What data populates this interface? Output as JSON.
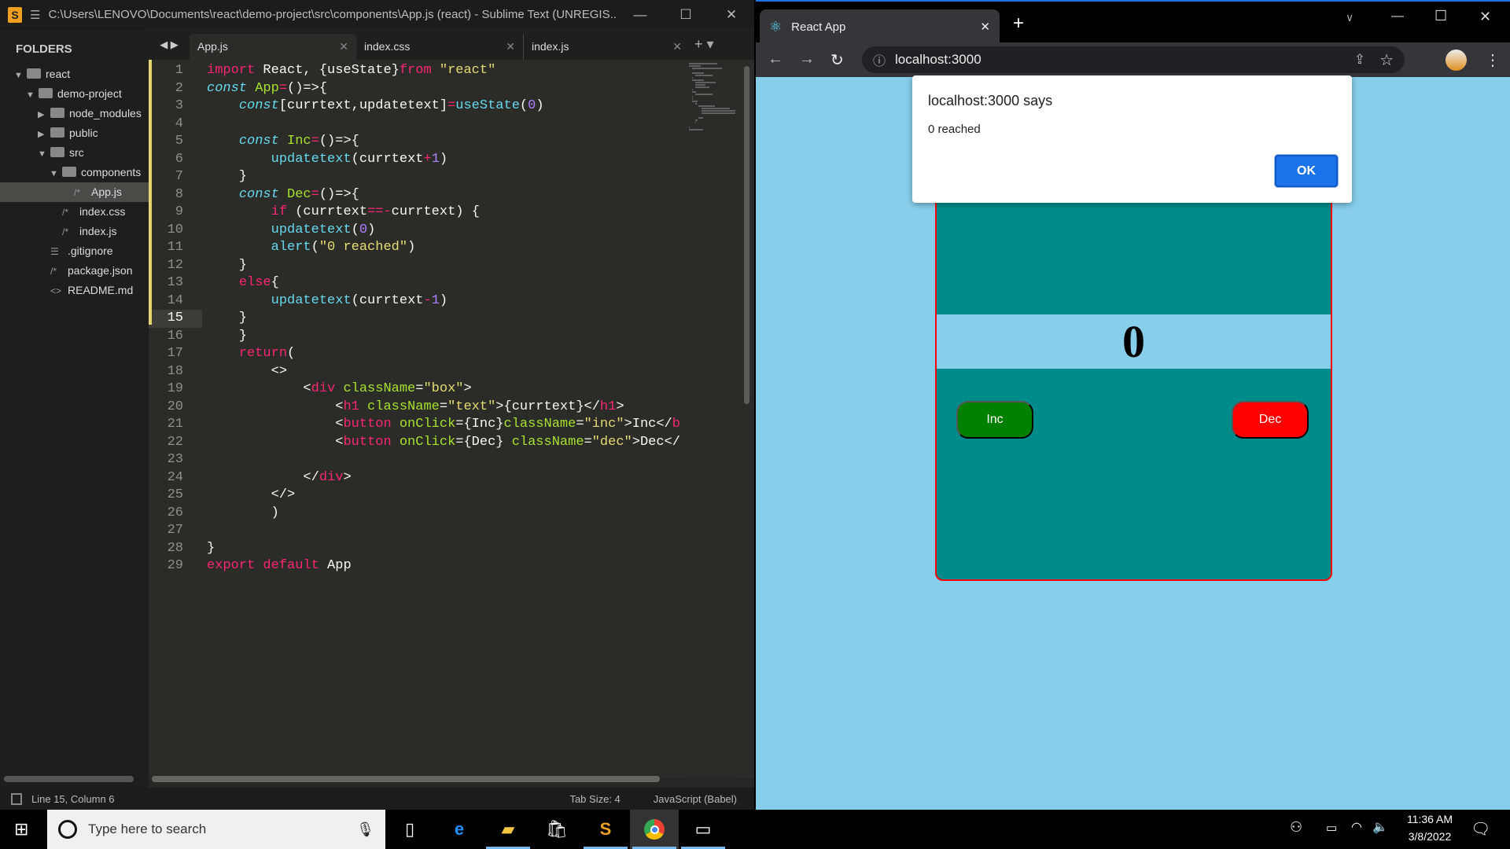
{
  "sublime": {
    "title": "C:\\Users\\LENOVO\\Documents\\react\\demo-project\\src\\components\\App.js (react) - Sublime Text (UNREGIS...",
    "tabs": [
      {
        "label": "App.js"
      },
      {
        "label": "index.css"
      },
      {
        "label": "index.js"
      }
    ],
    "sidebar": {
      "header": "FOLDERS",
      "items": [
        {
          "label": "react",
          "icon": "folder-open",
          "depth": 0,
          "arrow": "▼"
        },
        {
          "label": "demo-project",
          "icon": "folder-open",
          "depth": 1,
          "arrow": "▼"
        },
        {
          "label": "node_modules",
          "icon": "folder",
          "depth": 2,
          "arrow": "▶"
        },
        {
          "label": "public",
          "icon": "folder",
          "depth": 2,
          "arrow": "▶"
        },
        {
          "label": "src",
          "icon": "folder-open",
          "depth": 2,
          "arrow": "▼"
        },
        {
          "label": "components",
          "icon": "folder-open",
          "depth": 3,
          "arrow": "▼"
        },
        {
          "label": "App.js",
          "icon": "/*",
          "depth": 4,
          "selected": true
        },
        {
          "label": "index.css",
          "icon": "/*",
          "depth": 3
        },
        {
          "label": "index.js",
          "icon": "/*",
          "depth": 3
        },
        {
          "label": ".gitignore",
          "icon": "☰",
          "depth": 2
        },
        {
          "label": "package.json",
          "icon": "/*",
          "depth": 2
        },
        {
          "label": "README.md",
          "icon": "<>",
          "depth": 2
        }
      ]
    },
    "current_line": 15,
    "code": [
      [
        [
          "import",
          "kw"
        ],
        [
          " React, {useState}",
          ""
        ],
        [
          "from",
          "kw"
        ],
        [
          " ",
          ""
        ],
        [
          "\"react\"",
          "str"
        ]
      ],
      [
        [
          "const",
          "st"
        ],
        [
          " ",
          ""
        ],
        [
          "App",
          "fn"
        ],
        [
          "=",
          "kw"
        ],
        [
          "()=>{",
          ""
        ]
      ],
      [
        [
          "    ",
          ""
        ],
        [
          "const",
          "st"
        ],
        [
          "[currtext,updatetext]",
          ""
        ],
        [
          "=",
          "kw"
        ],
        [
          "useState",
          "fc"
        ],
        [
          "(",
          ""
        ],
        [
          "0",
          "num"
        ],
        [
          ")",
          ""
        ]
      ],
      [],
      [
        [
          "    ",
          ""
        ],
        [
          "const",
          "st"
        ],
        [
          " ",
          ""
        ],
        [
          "Inc",
          "fn"
        ],
        [
          "=",
          "kw"
        ],
        [
          "()=>{",
          ""
        ]
      ],
      [
        [
          "        ",
          ""
        ],
        [
          "updatetext",
          "fc"
        ],
        [
          "(currtext",
          ""
        ],
        [
          "+",
          "kw"
        ],
        [
          "1",
          "num"
        ],
        [
          ")",
          ""
        ]
      ],
      [
        [
          "    }",
          ""
        ]
      ],
      [
        [
          "    ",
          ""
        ],
        [
          "const",
          "st"
        ],
        [
          " ",
          ""
        ],
        [
          "Dec",
          "fn"
        ],
        [
          "=",
          "kw"
        ],
        [
          "()=>{",
          ""
        ]
      ],
      [
        [
          "        ",
          ""
        ],
        [
          "if",
          "kw"
        ],
        [
          " (currtext",
          ""
        ],
        [
          "==-",
          "kw"
        ],
        [
          "currtext) {",
          ""
        ]
      ],
      [
        [
          "        ",
          ""
        ],
        [
          "updatetext",
          "fc"
        ],
        [
          "(",
          ""
        ],
        [
          "0",
          "num"
        ],
        [
          ")",
          ""
        ]
      ],
      [
        [
          "        ",
          ""
        ],
        [
          "alert",
          "fc"
        ],
        [
          "(",
          ""
        ],
        [
          "\"0 reached\"",
          "str"
        ],
        [
          ")",
          ""
        ]
      ],
      [
        [
          "    }",
          ""
        ]
      ],
      [
        [
          "    ",
          ""
        ],
        [
          "else",
          "kw"
        ],
        [
          "{",
          ""
        ]
      ],
      [
        [
          "        ",
          ""
        ],
        [
          "updatetext",
          "fc"
        ],
        [
          "(currtext",
          ""
        ],
        [
          "-",
          "kw"
        ],
        [
          "1",
          "num"
        ],
        [
          ")",
          ""
        ]
      ],
      [
        [
          "    }",
          ""
        ]
      ],
      [
        [
          "    }",
          ""
        ]
      ],
      [
        [
          "    ",
          ""
        ],
        [
          "return",
          "kw"
        ],
        [
          "(",
          ""
        ]
      ],
      [
        [
          "        <>",
          ""
        ]
      ],
      [
        [
          "            <",
          ""
        ],
        [
          "div",
          "kw"
        ],
        [
          " ",
          ""
        ],
        [
          "className",
          "fn"
        ],
        [
          "=",
          ""
        ],
        [
          "\"box\"",
          "str"
        ],
        [
          ">",
          ""
        ]
      ],
      [
        [
          "                <",
          ""
        ],
        [
          "h1",
          "kw"
        ],
        [
          " ",
          ""
        ],
        [
          "className",
          "fn"
        ],
        [
          "=",
          ""
        ],
        [
          "\"text\"",
          "str"
        ],
        [
          ">{currtext}</",
          ""
        ],
        [
          "h1",
          "kw"
        ],
        [
          ">",
          ""
        ]
      ],
      [
        [
          "                <",
          ""
        ],
        [
          "button",
          "kw"
        ],
        [
          " ",
          ""
        ],
        [
          "onClick",
          "fn"
        ],
        [
          "={Inc}",
          ""
        ],
        [
          "className",
          "fn"
        ],
        [
          "=",
          ""
        ],
        [
          "\"inc\"",
          "str"
        ],
        [
          ">Inc</",
          ""
        ],
        [
          "b",
          "kw"
        ]
      ],
      [
        [
          "                <",
          ""
        ],
        [
          "button",
          "kw"
        ],
        [
          " ",
          ""
        ],
        [
          "onClick",
          "fn"
        ],
        [
          "={Dec} ",
          ""
        ],
        [
          "className",
          "fn"
        ],
        [
          "=",
          ""
        ],
        [
          "\"dec\"",
          "str"
        ],
        [
          ">Dec</",
          ""
        ]
      ],
      [],
      [
        [
          "            </",
          ""
        ],
        [
          "div",
          "kw"
        ],
        [
          ">",
          ""
        ]
      ],
      [
        [
          "        </>",
          ""
        ]
      ],
      [
        [
          "        )",
          ""
        ]
      ],
      [],
      [
        [
          "}",
          ""
        ]
      ],
      [
        [
          "export",
          "kw"
        ],
        [
          " ",
          ""
        ],
        [
          "default",
          "kw"
        ],
        [
          " App",
          ""
        ]
      ]
    ],
    "status": {
      "position": "Line 15, Column 6",
      "tab_size": "Tab Size: 4",
      "syntax": "JavaScript (Babel)"
    }
  },
  "browser": {
    "tab_title": "React App",
    "url": "localhost:3000",
    "page": {
      "counter": "0",
      "inc_label": "Inc",
      "dec_label": "Dec"
    },
    "alert": {
      "title": "localhost:3000 says",
      "message": "0 reached",
      "ok_label": "OK"
    }
  },
  "taskbar": {
    "search_placeholder": "Type here to search",
    "time": "11:36 AM",
    "date": "3/8/2022"
  },
  "colors": {
    "page_bg": "#87ceeb",
    "box_bg": "#008b8b",
    "inc": "#008000",
    "dec": "#ff0000",
    "accent": "#1a73e8"
  }
}
